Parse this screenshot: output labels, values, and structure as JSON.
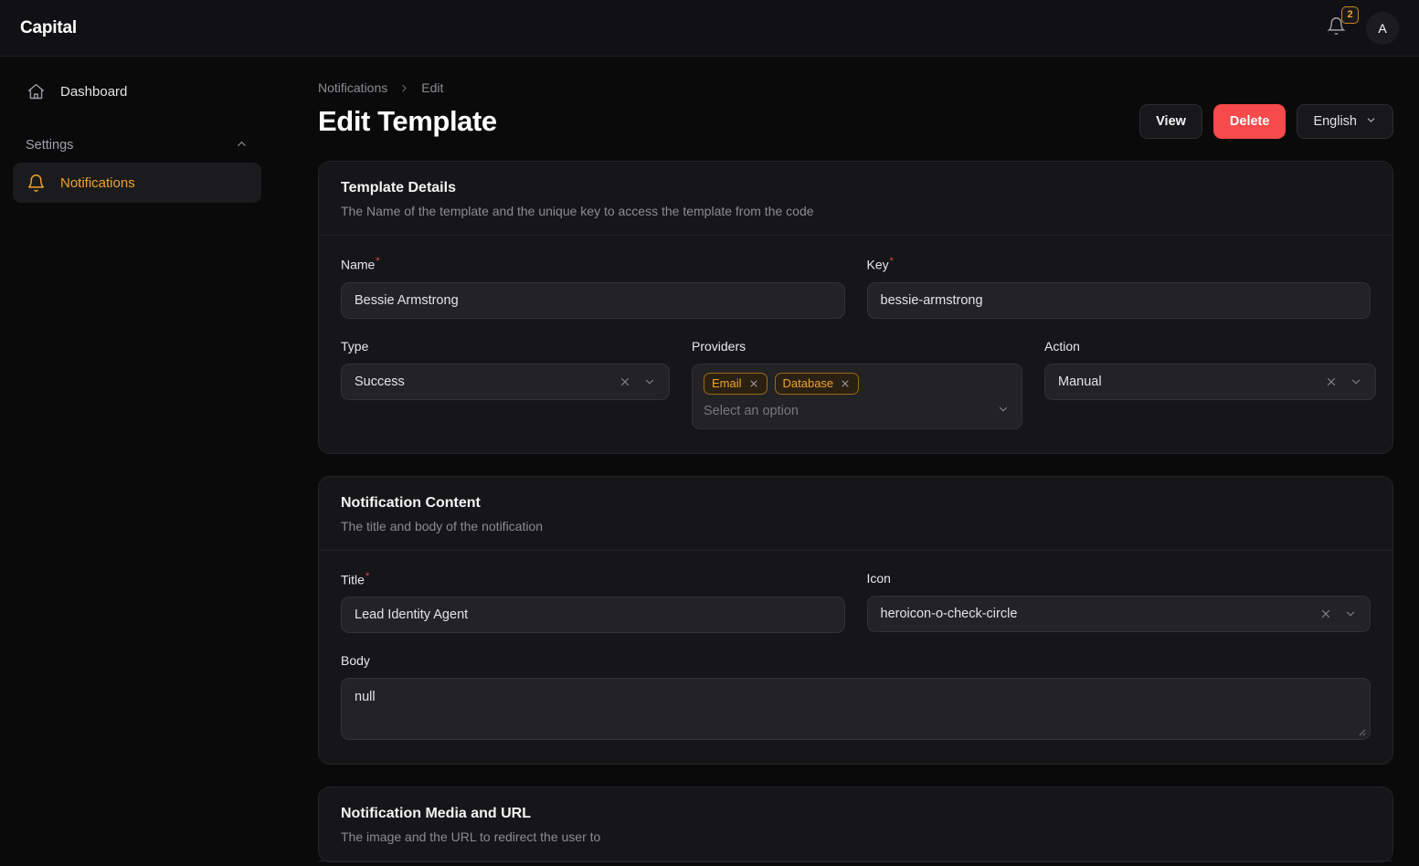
{
  "topbar": {
    "brand": "Capital",
    "bell_icon": "bell-icon",
    "notification_count": "2",
    "avatar_initial": "A"
  },
  "sidebar": {
    "dashboard": {
      "label": "Dashboard",
      "icon": "home-icon"
    },
    "settings_group": {
      "label": "Settings",
      "icon": "chevron-up-icon"
    },
    "notifications": {
      "label": "Notifications",
      "icon": "bell-icon"
    }
  },
  "breadcrumb": {
    "parent": "Notifications",
    "separator_icon": "chevron-right-icon",
    "current": "Edit"
  },
  "header": {
    "title": "Edit Template",
    "view_label": "View",
    "delete_label": "Delete",
    "language_label": "English",
    "language_icon": "chevron-down-icon"
  },
  "colors": {
    "accent": "#f0a32a",
    "danger": "#f74a4a",
    "required": "#ef4444",
    "page_bg": "#0a0a0b",
    "card_bg": "#161618",
    "input_bg": "#232326"
  },
  "sections": {
    "template_details": {
      "title": "Template Details",
      "subtitle": "The Name of the template and the unique key to access the template from the code",
      "name": {
        "label": "Name",
        "required": "*",
        "value": "Bessie Armstrong"
      },
      "key": {
        "label": "Key",
        "required": "*",
        "value": "bessie-armstrong"
      },
      "type": {
        "label": "Type",
        "value": "Success",
        "clear_icon": "close-icon",
        "chevron_icon": "chevron-down-icon"
      },
      "providers": {
        "label": "Providers",
        "tags": [
          "Email",
          "Database"
        ],
        "tag_remove_icon": "close-icon",
        "placeholder": "Select an option",
        "chevron_icon": "chevron-down-icon"
      },
      "action": {
        "label": "Action",
        "value": "Manual",
        "clear_icon": "close-icon",
        "chevron_icon": "chevron-down-icon"
      }
    },
    "notification_content": {
      "title": "Notification Content",
      "subtitle": "The title and body of the notification",
      "title_field": {
        "label": "Title",
        "required": "*",
        "value": "Lead Identity Agent"
      },
      "icon_field": {
        "label": "Icon",
        "value": "heroicon-o-check-circle",
        "clear_icon": "close-icon",
        "chevron_icon": "chevron-down-icon"
      },
      "body_field": {
        "label": "Body",
        "value": "null"
      }
    },
    "notification_media": {
      "title": "Notification Media and URL",
      "subtitle": "The image and the URL to redirect the user to"
    }
  }
}
